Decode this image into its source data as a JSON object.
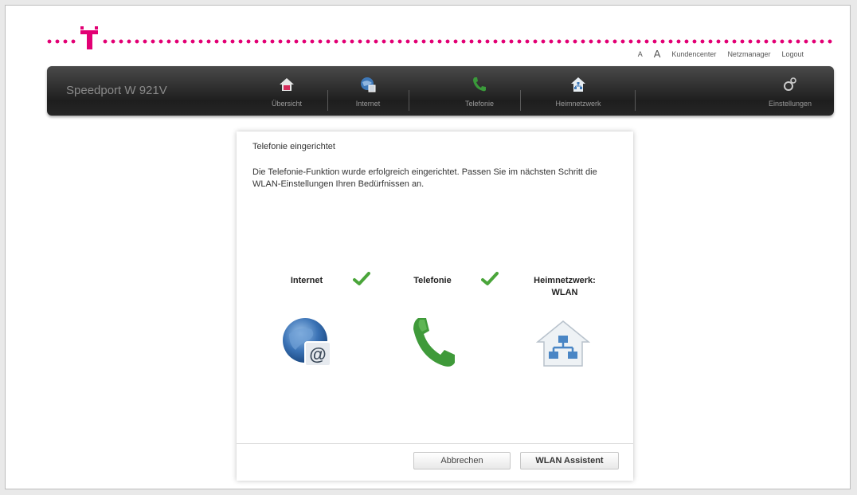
{
  "colors": {
    "magenta": "#e20074",
    "check_green": "#4aa53a",
    "nav_bg": "#2b2b2b"
  },
  "topbar": {
    "font_small": "A",
    "font_large": "A",
    "links": [
      "Kundencenter",
      "Netzmanager",
      "Logout"
    ]
  },
  "nav": {
    "product": "Speedport W 921V",
    "items": [
      {
        "label": "Übersicht",
        "icon": "home-icon"
      },
      {
        "label": "Internet",
        "icon": "internet-icon"
      },
      {
        "label": "Telefonie",
        "icon": "phone-icon"
      },
      {
        "label": "Heimnetzwerk",
        "icon": "home-network-icon"
      }
    ],
    "settings": {
      "label": "Einstellungen",
      "icon": "settings-icon"
    }
  },
  "dialog": {
    "title": "Telefonie eingerichtet",
    "text": "Die Telefonie-Funktion wurde erfolgreich eingerichtet. Passen Sie im nächsten Schritt die WLAN-Einstellungen Ihren Bedürfnissen an.",
    "steps": [
      {
        "label": "Internet",
        "done": true,
        "icon": "globe-email-icon"
      },
      {
        "label": "Telefonie",
        "done": true,
        "icon": "phone-handset-icon"
      },
      {
        "label_line1": "Heimnetzwerk:",
        "label_line2": "WLAN",
        "done": false,
        "icon": "home-network-icon"
      }
    ],
    "buttons": {
      "cancel": "Abbrechen",
      "primary": "WLAN Assistent"
    }
  }
}
